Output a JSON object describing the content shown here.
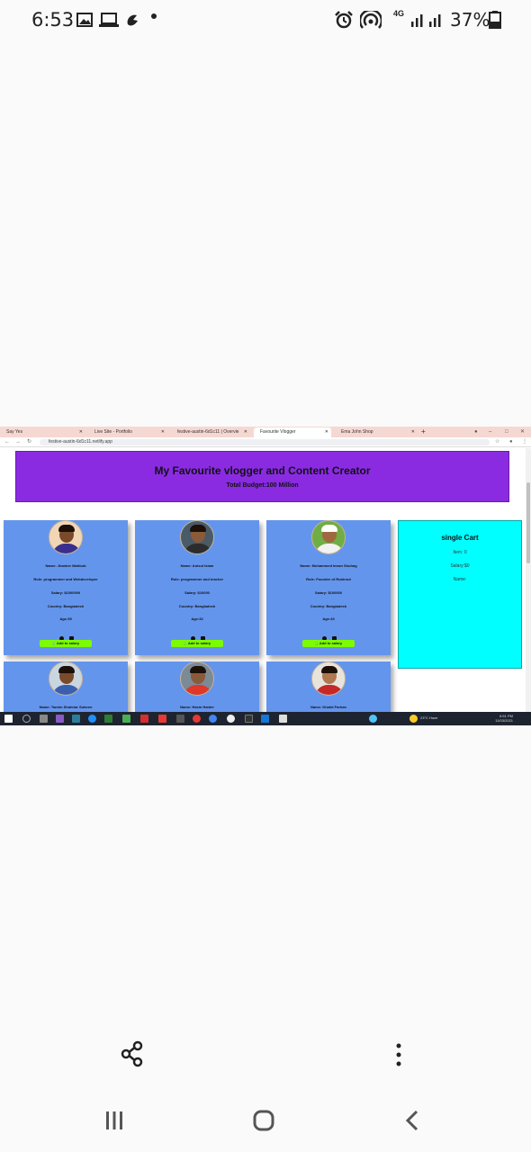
{
  "status_bar": {
    "time": "6:53",
    "network": "4G",
    "battery_percent": "37%"
  },
  "browser": {
    "tabs": [
      {
        "label": "Say Yes",
        "active": false
      },
      {
        "label": "Live Site - Portfolio",
        "active": false
      },
      {
        "label": "festive-austin-6d1c11 | Overvie",
        "active": false
      },
      {
        "label": "Favourite Vlogger",
        "active": true
      },
      {
        "label": "Ema John Shop",
        "active": false
      }
    ],
    "url": "festive-austin-6d1c11.netlify.app"
  },
  "page": {
    "title": "My Favourite vlogger and Content Creator",
    "budget": "Total Budget:100 Million",
    "cards": [
      {
        "name": "Name: Jhanker Mahbub",
        "role": "Role: programmer and Webdeveloper",
        "salary": "Salary: $1000000",
        "country": "Country: Bangladesh",
        "age": "Age:35",
        "button": "Add to salary",
        "shirt": "#3a2f8c",
        "skin": "#7a4a2a",
        "bg": "#f1d6b6"
      },
      {
        "name": "Name: Anisul Islam",
        "role": "Role: programmer and teacher",
        "salary": "Salary: $10000",
        "country": "Country: Bangladesh",
        "age": "Age:32",
        "button": "Add to salary",
        "shirt": "#2c2c2c",
        "skin": "#8a5a3a",
        "bg": "#4a5a66"
      },
      {
        "name": "Name: Mohammed Imran Shuhag",
        "role": "Role: Founder of Rubirnut",
        "salary": "Salary: $100000",
        "country": "Country: Bangladesh",
        "age": "Age:40",
        "button": "Add to salary",
        "shirt": "#f2f2f2",
        "skin": "#a06840",
        "bg": "#6fae45"
      },
      {
        "name": "Name: Tamim Shahriar Subeen",
        "shirt": "#3b5fb0",
        "skin": "#7a4a2a",
        "bg": "#c9d6e0"
      },
      {
        "name": "Name: Hasin Haider",
        "shirt": "#e0372a",
        "skin": "#8a5a3a",
        "bg": "#7c8a95"
      },
      {
        "name": "Name: Khalid Farhan",
        "shirt": "#c62828",
        "skin": "#b07850",
        "bg": "#e8e4dc"
      }
    ],
    "cart": {
      "title": "single Cart",
      "item_count": "Item: 0",
      "salary": "Salary:$0",
      "names_label": "Name:"
    }
  },
  "taskbar": {
    "time": "6:51 PM",
    "date": "11/03/2021",
    "weather": "23°C Haze"
  }
}
